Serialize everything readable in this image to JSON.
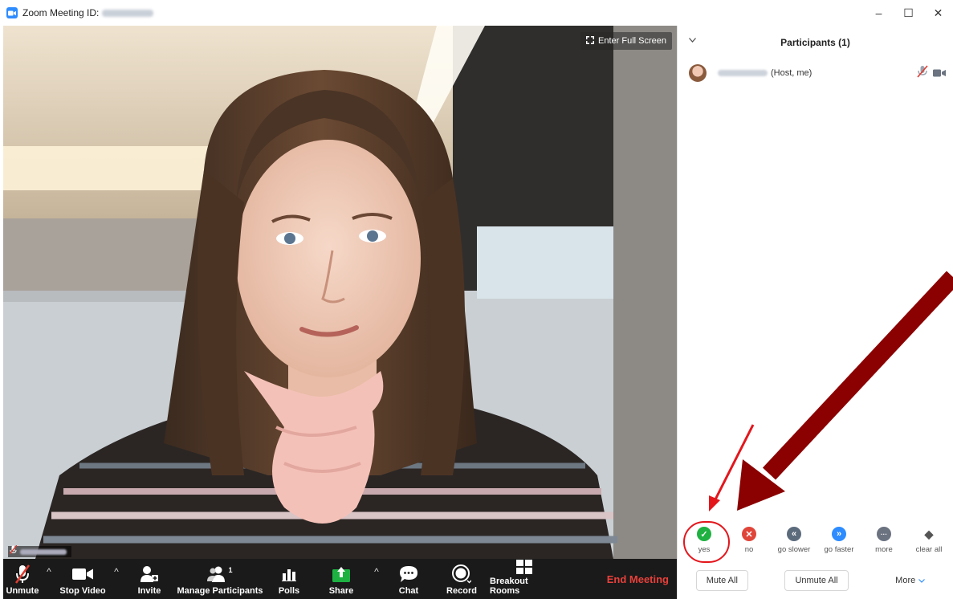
{
  "window": {
    "title": "Zoom Meeting ID:",
    "minimize": "–",
    "maximize": "☐",
    "close": "✕"
  },
  "video": {
    "fullscreen_label": "Enter Full Screen"
  },
  "toolbar": {
    "unmute": "Unmute",
    "stop_video": "Stop Video",
    "invite": "Invite",
    "manage_participants": "Manage Participants",
    "participant_count": "1",
    "polls": "Polls",
    "share": "Share",
    "chat": "Chat",
    "record": "Record",
    "breakout_rooms": "Breakout Rooms",
    "end_meeting": "End Meeting",
    "caret": "^"
  },
  "panel": {
    "title": "Participants (1)",
    "participant_role": "(Host, me)",
    "reactions": [
      {
        "label": "yes",
        "color": "#1fb141",
        "glyph": "✓"
      },
      {
        "label": "no",
        "color": "#e0453a",
        "glyph": "✕"
      },
      {
        "label": "go slower",
        "color": "#5c6b7c",
        "glyph": "«"
      },
      {
        "label": "go faster",
        "color": "#2d8cff",
        "glyph": "»"
      },
      {
        "label": "more",
        "color": "#6b7280",
        "glyph": "···"
      },
      {
        "label": "clear all",
        "color": "#555",
        "glyph": "◆"
      }
    ],
    "mute_all": "Mute All",
    "unmute_all": "Unmute All",
    "more": "More"
  },
  "colors": {
    "accent": "#2d8cff",
    "end_meeting": "#e8403b",
    "share_green": "#1db142",
    "annotation_dark_red": "#8b0000",
    "annotation_red": "#e3161c"
  }
}
